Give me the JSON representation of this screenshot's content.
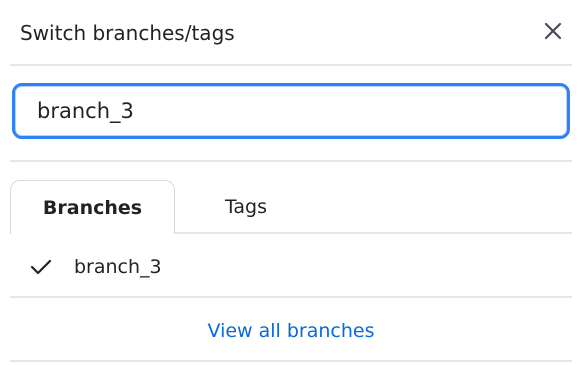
{
  "header": {
    "title": "Switch branches/tags",
    "close_icon": "close-icon"
  },
  "search": {
    "value": "branch_3",
    "placeholder": ""
  },
  "tabs": [
    {
      "label": "Branches",
      "selected": true
    },
    {
      "label": "Tags",
      "selected": false
    }
  ],
  "branches": [
    {
      "name": "branch_3",
      "checked": true,
      "icon": "check-icon"
    }
  ],
  "footer": {
    "view_all_label": "View all branches"
  },
  "colors": {
    "accent": "#2f81f7",
    "link": "#0969da",
    "text": "#1f2328",
    "border": "#e3e6ea"
  }
}
